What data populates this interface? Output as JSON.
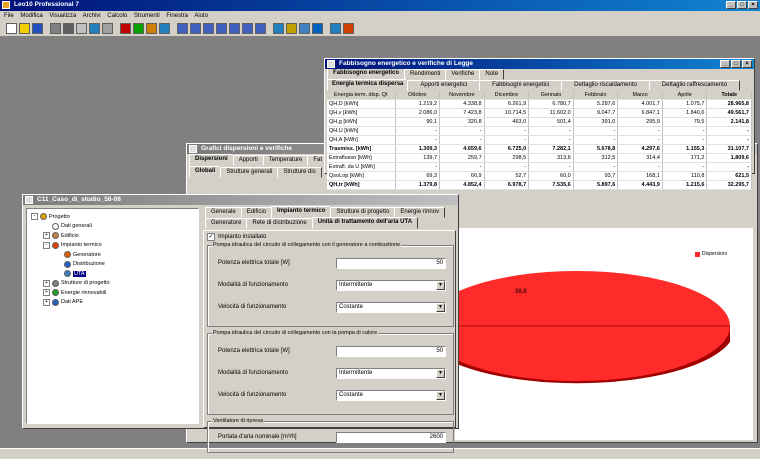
{
  "app": {
    "title": "Leo10 Professional 7"
  },
  "menu": [
    "File",
    "Modifica",
    "Visualizza",
    "Archivi",
    "Calcolo",
    "Strumenti",
    "Finestra",
    "Aiuto"
  ],
  "toolbar": {
    "icons": [
      "new-icon",
      "open-icon",
      "save-icon",
      "print-icon",
      "preview-icon",
      "cut-icon",
      "copy-icon",
      "paste-icon",
      "color-icon",
      "building-icon",
      "chart-icon",
      "settings-icon",
      "zoom-icon",
      "zoom-icon",
      "zoom-icon",
      "zoom-icon",
      "zoom-icon",
      "zoom-icon",
      "zoom-icon",
      "grid-icon",
      "report-icon",
      "help-icon",
      "info-icon",
      "list-icon",
      "chart-icon"
    ]
  },
  "fabbisogno": {
    "title": "Fabbisogno energetico e verifiche di Legge",
    "tabs": [
      "Fabbisogno energetico",
      "Rendimenti",
      "Verifiche",
      "Note"
    ],
    "subtabs": [
      "Energia termica dispersa",
      "Apporti energetici",
      "Fabbisogni energetici",
      "Dettaglio riscaldamento",
      "Dettaglio raffrescamento"
    ],
    "header": [
      "Energia term. disp. Qt",
      "Ottobre",
      "Novembre",
      "Dicembre",
      "Gennaio",
      "Febbraio",
      "Marzo",
      "Aprile",
      "Totale"
    ],
    "rows": [
      {
        "label": "QH,D [kWh]",
        "bold": false,
        "values": [
          "1.219,2",
          "4.338,8",
          "6.261,9",
          "6.780,7",
          "5.287,6",
          "4.001,7",
          "1.075,7",
          "28.965,8"
        ]
      },
      {
        "label": "QH,v [kWh]",
        "bold": false,
        "values": [
          "2.086,0",
          "7.423,8",
          "10.714,5",
          "11.602,0",
          "9.047,7",
          "6.847,1",
          "1.840,6",
          "49.561,7"
        ]
      },
      {
        "label": "QH,g [kWh]",
        "bold": false,
        "values": [
          "90,1",
          "320,8",
          "463,0",
          "501,4",
          "391,0",
          "295,9",
          "79,5",
          "2.141,8"
        ]
      },
      {
        "label": "QH,U [kWh]",
        "bold": false,
        "values": [
          "-",
          "-",
          "-",
          "-",
          "-",
          "-",
          "-",
          "-"
        ]
      },
      {
        "label": "QH,A [kWh]",
        "bold": false,
        "values": [
          "-",
          "-",
          "-",
          "-",
          "-",
          "-",
          "-",
          "-"
        ]
      },
      {
        "label": "Trasmiss. [kWh]",
        "bold": true,
        "values": [
          "1.309,3",
          "4.659,6",
          "6.725,0",
          "7.282,1",
          "5.678,8",
          "4.297,6",
          "1.155,3",
          "31.107,7"
        ]
      },
      {
        "label": "Extraflusso [kWh]",
        "bold": false,
        "values": [
          "139,7",
          "259,7",
          "298,5",
          "313,6",
          "312,5",
          "314,4",
          "171,2",
          "1.809,6"
        ]
      },
      {
        "label": "Extrafl. da U [kWh]",
        "bold": false,
        "values": [
          "-",
          "-",
          "-",
          "-",
          "-",
          "-",
          "-",
          "-"
        ]
      },
      {
        "label": "QsoLop [kWh]",
        "bold": false,
        "values": [
          "69,3",
          "66,9",
          "52,7",
          "60,0",
          "93,7",
          "168,1",
          "110,8",
          "621,5"
        ]
      },
      {
        "label": "QH,tr [kWh]",
        "bold": true,
        "values": [
          "1.379,8",
          "4.852,4",
          "6.978,7",
          "7.535,6",
          "5.897,6",
          "4.443,9",
          "1.215,6",
          "32.295,7"
        ]
      }
    ]
  },
  "grafici": {
    "title": "Grafici dispersioni e verifiche",
    "tabs": [
      "Dispersioni",
      "Apporti",
      "Temperature",
      "Fat"
    ],
    "subtabs": [
      "Globali",
      "Strutture generali",
      "Strutture dis"
    ],
    "pie_label": "38,6",
    "legend_text": "Dispersioni"
  },
  "caso": {
    "title": "C11_Caso_di_studio_58-08",
    "tree": [
      {
        "label": "Progetto",
        "icon": "project-icon",
        "level": 0,
        "expander": "-"
      },
      {
        "label": "Dati generali",
        "icon": "doc-icon",
        "level": 1,
        "expander": ""
      },
      {
        "label": "Edificio",
        "icon": "building-icon",
        "level": 1,
        "expander": "+"
      },
      {
        "label": "Impianto termico",
        "icon": "heating-icon",
        "level": 1,
        "expander": "-"
      },
      {
        "label": "Generatore",
        "icon": "boiler-icon",
        "level": 2,
        "expander": ""
      },
      {
        "label": "Distribuzione",
        "icon": "distribution-icon",
        "level": 2,
        "expander": ""
      },
      {
        "label": "UTA",
        "icon": "uta-icon",
        "level": 2,
        "expander": ""
      },
      {
        "label": "Strutture di progetto",
        "icon": "structure-icon",
        "level": 1,
        "expander": "+"
      },
      {
        "label": "Energie rinnovabili",
        "icon": "renewable-icon",
        "level": 1,
        "expander": "+"
      },
      {
        "label": "Dati APE",
        "icon": "ape-icon",
        "level": 1,
        "expander": "+"
      }
    ],
    "tabs": [
      "Generale",
      "Edificio",
      "Impianto termico",
      "Strutture di progetto",
      "Energie rinnov"
    ],
    "subtabs": [
      "Generatore",
      "Rete di distribuzione",
      "Unità di trattamento dell'aria UTA"
    ],
    "checkbox": {
      "label": "Impianto installato",
      "checked": true
    },
    "group1": {
      "title": "Pompa idraulica del circuito di collegamento con il generatore a combustione",
      "potenza_label": "Potenza elettrica totale [W]",
      "potenza_value": "50",
      "modalita_label": "Modalità di funzionamento",
      "modalita_value": "Intermittente",
      "velocita_label": "Velocità di funzionamento",
      "velocita_value": "Costante"
    },
    "group2": {
      "title": "Pompa idraulica del circuito di collegamento con la pompa di calore",
      "potenza_label": "Potenza elettrica totale [W]",
      "potenza_value": "50",
      "modalita_label": "Modalità di funzionamento",
      "modalita_value": "Intermittente",
      "velocita_label": "Velocità di funzionamento",
      "velocita_value": "Costante"
    },
    "group3": {
      "title": "Ventilatore di ripresa",
      "portata_label": "Portata d'aria nominale [m³/h]",
      "portata_value": "2600"
    }
  },
  "colors": {
    "title_active": "#00107a",
    "pie": "#ff2a2a",
    "pie_dark": "#a00000",
    "desktop": "#808080"
  }
}
